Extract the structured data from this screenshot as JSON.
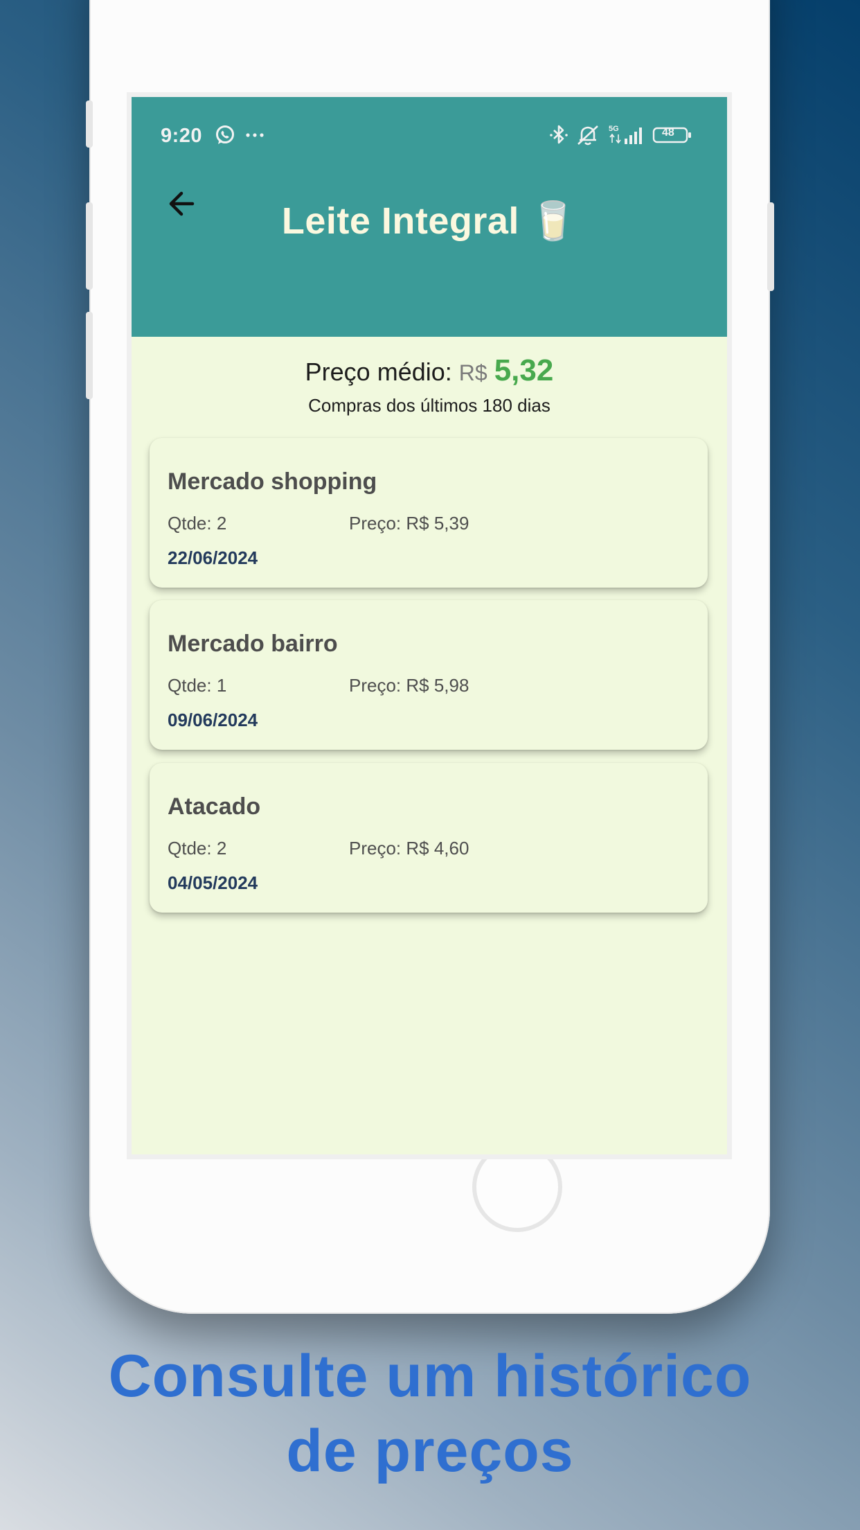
{
  "status_bar": {
    "time": "9:20",
    "battery": "48"
  },
  "header": {
    "title": "Leite Integral 🥛"
  },
  "summary": {
    "avg_label": "Preço médio:",
    "currency": "R$",
    "avg_value": "5,32",
    "subtitle": "Compras dos últimos 180 dias"
  },
  "purchases": [
    {
      "store": "Mercado shopping",
      "qty": "Qtde: 2",
      "price": "Preço: R$ 5,39",
      "date": "22/06/2024"
    },
    {
      "store": "Mercado bairro",
      "qty": "Qtde: 1",
      "price": "Preço: R$ 5,98",
      "date": "09/06/2024"
    },
    {
      "store": "Atacado",
      "qty": "Qtde: 2",
      "price": "Preço: R$ 4,60",
      "date": "04/05/2024"
    }
  ],
  "caption": {
    "line1": "Consulte um histórico",
    "line2": "de preços"
  },
  "colors": {
    "appbar": "#3b9b98",
    "price_accent": "#48a94e",
    "caption": "#2f6fd0",
    "screen_bg": "#f1f9de"
  }
}
